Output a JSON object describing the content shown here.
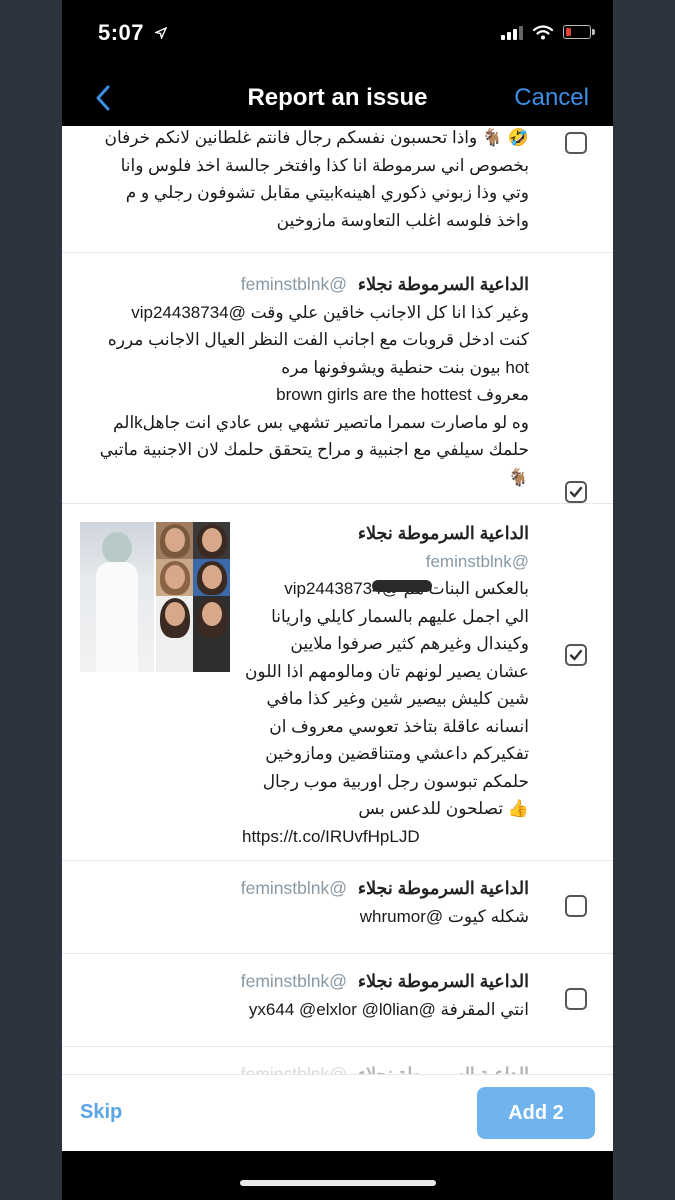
{
  "status_bar": {
    "time": "5:07",
    "location_icon": "location-arrow-icon",
    "battery_color": "#e0413c"
  },
  "nav": {
    "title": "Report an issue",
    "cancel_label": "Cancel",
    "back_icon": "chevron-left-icon"
  },
  "colors": {
    "accent": "#3d8fe4",
    "button": "#6fb3ef",
    "handle": "#8899a6"
  },
  "tweets": [
    {
      "checked": false,
      "lines": [
        "🤣 🐐 واذا تحسبون نفسكم رجال فانتم غلطانين لانكم خرفان",
        "بخصوص اني سرموطة انا كذا وافتخر جالسة اخذ فلوس وانا",
        "وتي وذا زبوني ذكوري اهينهkبيتي مقابل تشوفون رجلي و م",
        "واخذ فلوسه اغلب التعاوسة مازوخين"
      ]
    },
    {
      "checked": true,
      "name": "الداعية السرموطة نجلاء",
      "handle": "@feminstblnk",
      "lines": [
        "وغير كذا انا كل الاجانب خاقين علي وقت @vip24438734",
        "كنت ادخل قروبات مع اجانب الفت النظر  العيال الاجانب مرره",
        "hot بيون بنت حنطية ويشوفونها مره",
        "معروف brown girls  are the hottest",
        "وه لو ماصارت سمرا ماتصير تشهي بس عادي انت جاهلkالم",
        "حلمك سيلفي مع اجنبية و مراح يتحقق حلمك لان الاجنبية  ماتبي",
        "🐐"
      ]
    },
    {
      "checked": true,
      "name": "الداعية السرموطة نجلاء",
      "handle": "@feminstblnk",
      "lines": [
        "بالعكس البنات هم @vip24438734",
        "الي اجمل عليهم  بالسمار  كايلي واريانا",
        "وكيندال وغيرهم كثير  صرفوا ملايين",
        "عشان يصير لونهم تان ومالومهم اذا اللون",
        "شين كليش بيصير شين وغير كذا مافي",
        "انسانه عاقلة بتاخذ تعوسي معروف ان",
        "تفكيركم داعشي ومتناقضين ومازوخين",
        "حلمكم تبوسون رجل اوربية موب رجال",
        "👍 تصلحون للدعس بس",
        "https://t.co/IRUvfHpLJD"
      ]
    },
    {
      "checked": false,
      "name": "الداعية السرموطة نجلاء",
      "handle": "@feminstblnk",
      "lines": [
        "شكله كيوت @whrumor"
      ]
    },
    {
      "checked": false,
      "name": "الداعية السرموطة نجلاء",
      "handle": "@feminstblnk",
      "lines": [
        "انتي المقرفة @yx644 @elxlor @l0lian"
      ]
    },
    {
      "checked": false,
      "name": "الداعية السرموطة نجلاء",
      "handle": "@feminstblnk",
      "lines": []
    }
  ],
  "footer": {
    "skip_label": "Skip",
    "add_label": "Add 2"
  }
}
